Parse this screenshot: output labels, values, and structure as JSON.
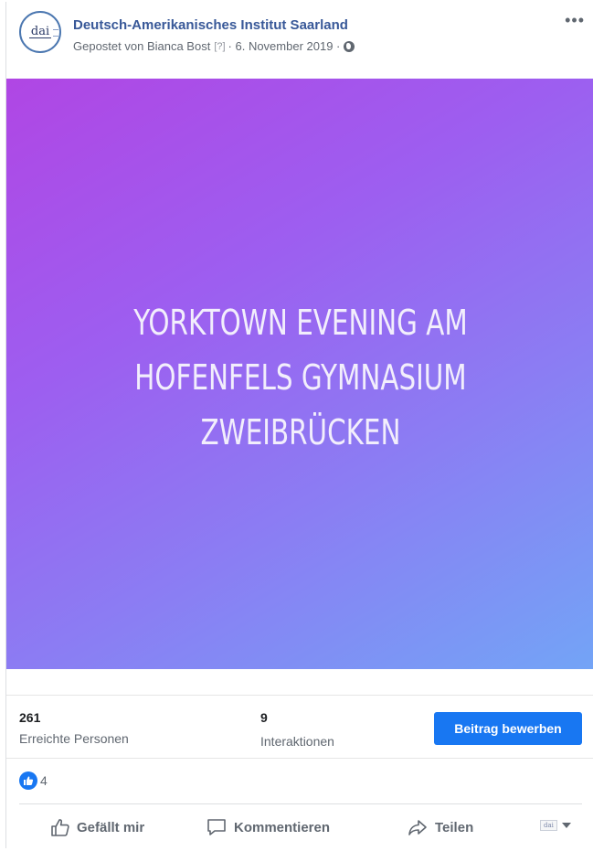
{
  "post": {
    "page_name": "Deutsch-Amerikanisches Institut Saarland",
    "meta_prefix": "Gepostet von Bianca Bost",
    "meta_q": "[?]",
    "meta_date": "· 6. November 2019 ·",
    "avatar_text": "dai",
    "more_label": "•••"
  },
  "image": {
    "lines": [
      "YORKTOWN EVENING AM",
      "HOFENFELS GYMNASIUM",
      "ZWEIBRÜCKEN"
    ]
  },
  "stats": {
    "reach_value": "261",
    "reach_label": "Erreichte Personen",
    "engagement_value": "9",
    "engagement_label": "Interaktionen",
    "boost_label": "Beitrag bewerben"
  },
  "reactions": {
    "count": "4"
  },
  "actions": {
    "like": "Gefällt mir",
    "comment": "Kommentieren",
    "share": "Teilen"
  },
  "page_switch": {
    "logo_text": "dai"
  },
  "colors": {
    "link": "#385898",
    "accent": "#1877f2",
    "gradient_start": "#b046e4",
    "gradient_end": "#73a4f6"
  }
}
